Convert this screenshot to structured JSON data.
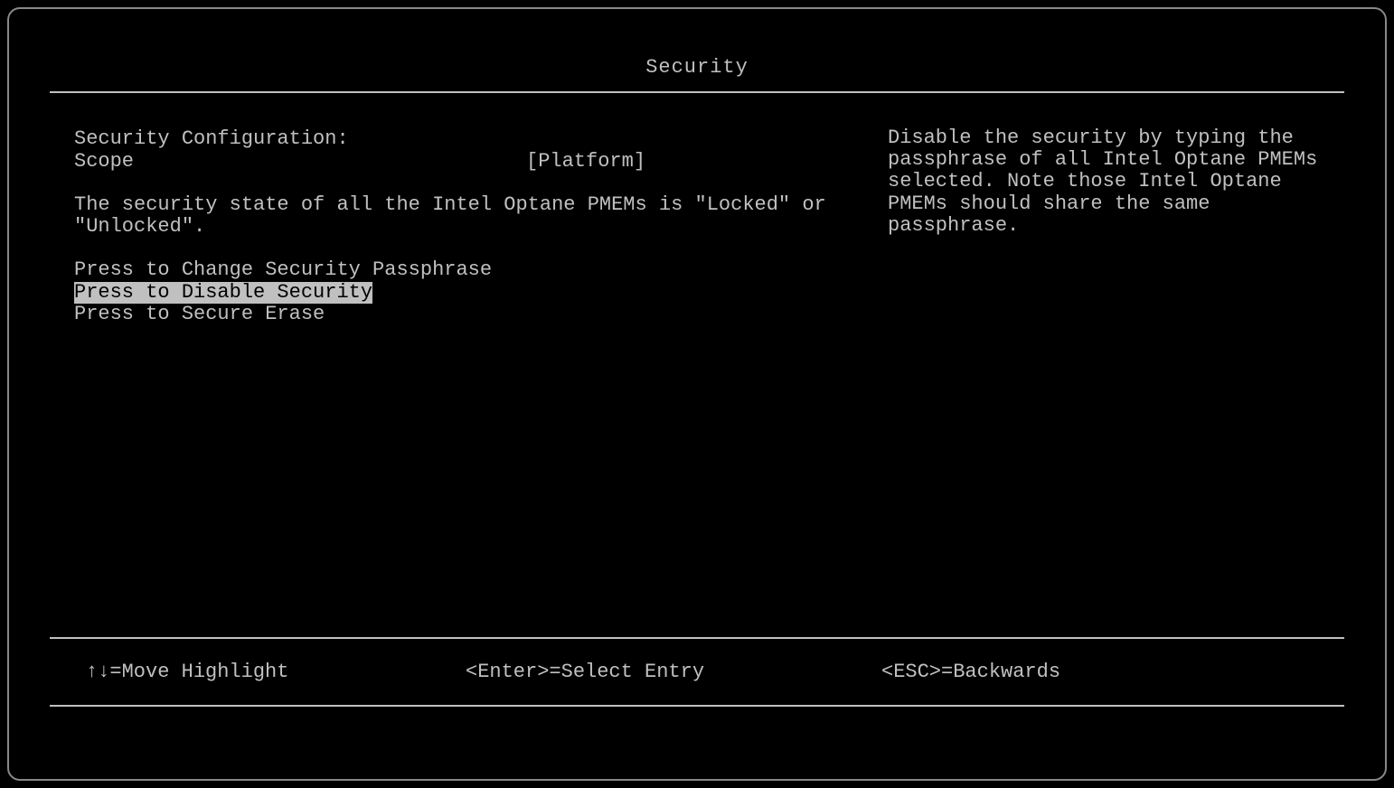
{
  "title": "Security",
  "main": {
    "heading": "Security Configuration:",
    "scope_label": "Scope",
    "scope_value": "[Platform]",
    "description": "The security state of all the Intel Optane PMEMs is \"Locked\" or \"Unlocked\".",
    "menu_items": [
      {
        "label": "Press to Change Security Passphrase",
        "selected": false
      },
      {
        "label": "Press to Disable Security",
        "selected": true
      },
      {
        "label": "Press to Secure Erase",
        "selected": false
      }
    ]
  },
  "help": "Disable the security by typing the passphrase of all Intel Optane PMEMs selected. Note those Intel Optane PMEMs should share the same passphrase.",
  "footer": {
    "hint_move_arrows": "↑↓",
    "hint_move_label": "=Move Highlight",
    "hint_enter": "<Enter>=Select Entry",
    "hint_esc": "<ESC>=Backwards"
  }
}
